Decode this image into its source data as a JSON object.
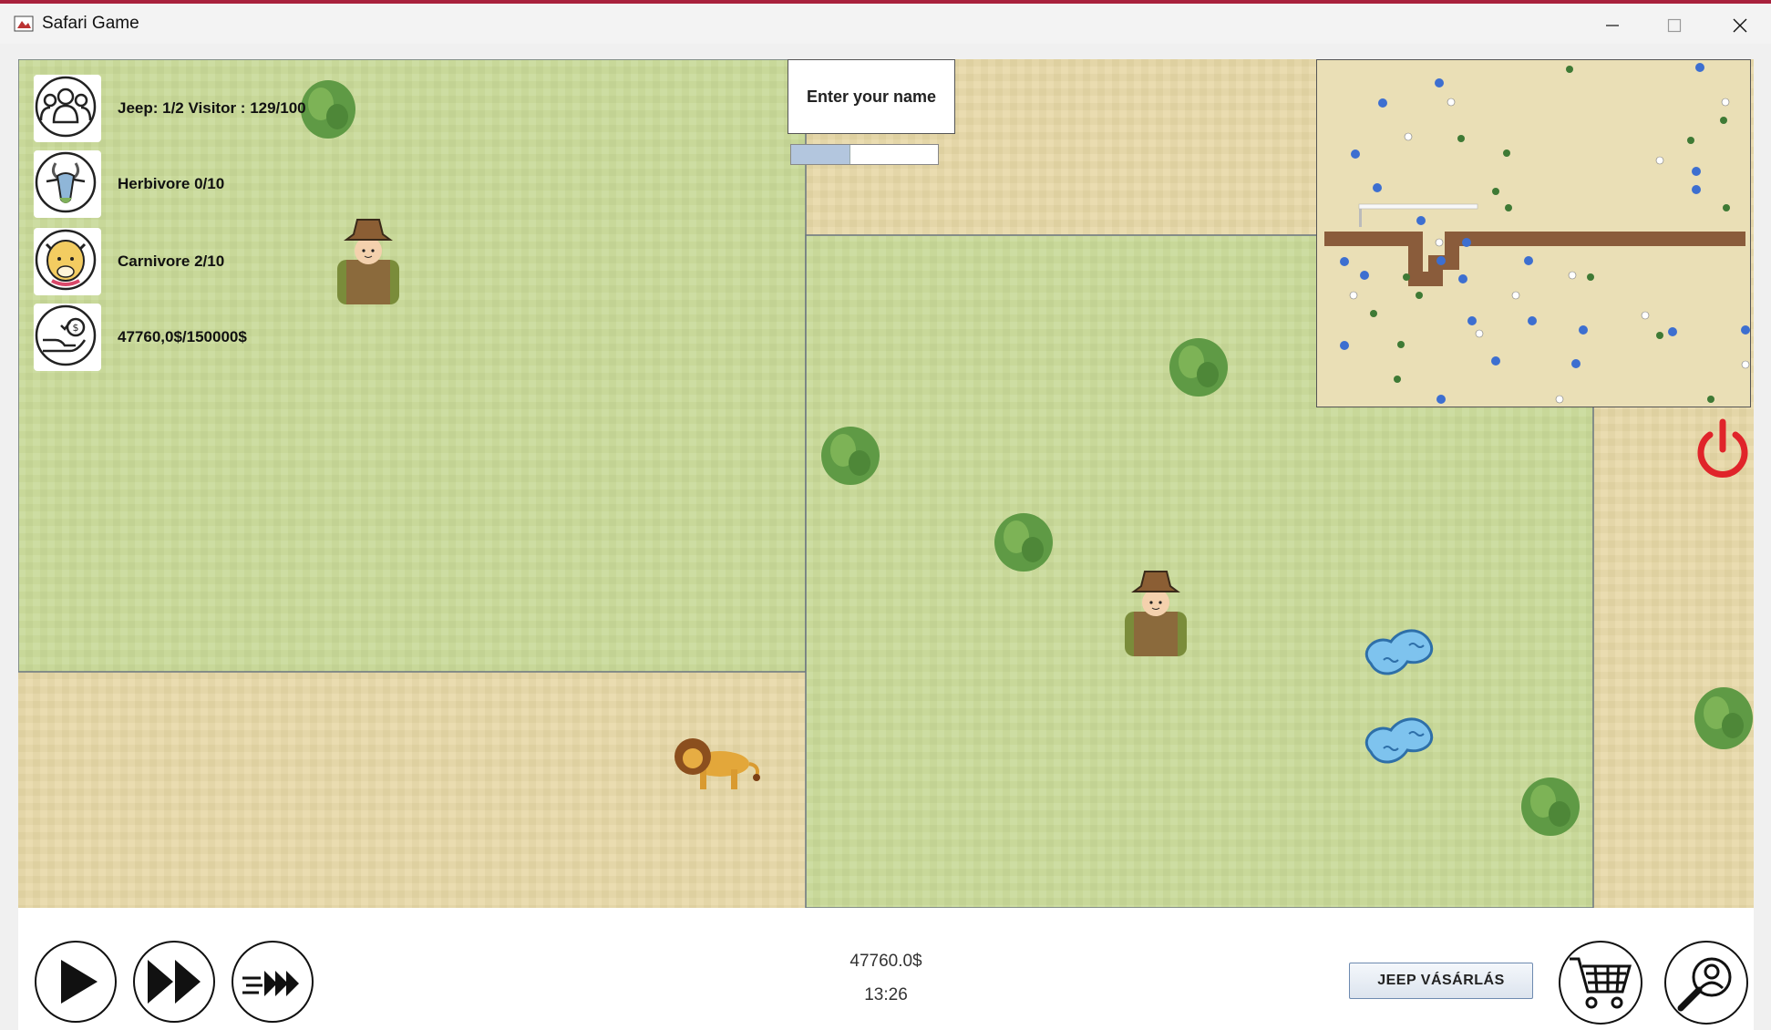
{
  "window": {
    "title": "Safari Game",
    "controls": [
      "minimize",
      "maximize",
      "close"
    ]
  },
  "hud": {
    "visitors": {
      "label": "Jeep: 1/2 Visitor : 129/100",
      "icon": "people-group-icon"
    },
    "herbivore": {
      "label": "Herbivore 0/10",
      "icon": "goat-icon"
    },
    "carnivore": {
      "label": "Carnivore 2/10",
      "icon": "leopard-icon"
    },
    "money": {
      "label": "47760,0$/150000$",
      "icon": "money-hand-icon"
    }
  },
  "name_input": {
    "placeholder": "Enter your name"
  },
  "progress": {
    "value": 0.4
  },
  "bottom_bar": {
    "balance": "47760.0$",
    "time": "13:26",
    "buy_jeep_label": "JEEP VÁSÁRLÁS",
    "speed_controls": [
      "play-icon",
      "fast-forward-icon",
      "fastest-speed-icon"
    ],
    "right_icons": [
      "shopping-cart-icon",
      "search-user-icon"
    ]
  },
  "colors": {
    "grass": "#c9d99b",
    "sand": "#e3d5a7",
    "water": "#7ec3ee",
    "road": "#8a5c3b",
    "power": "#e0242a",
    "title_accent": "#a8213c"
  }
}
